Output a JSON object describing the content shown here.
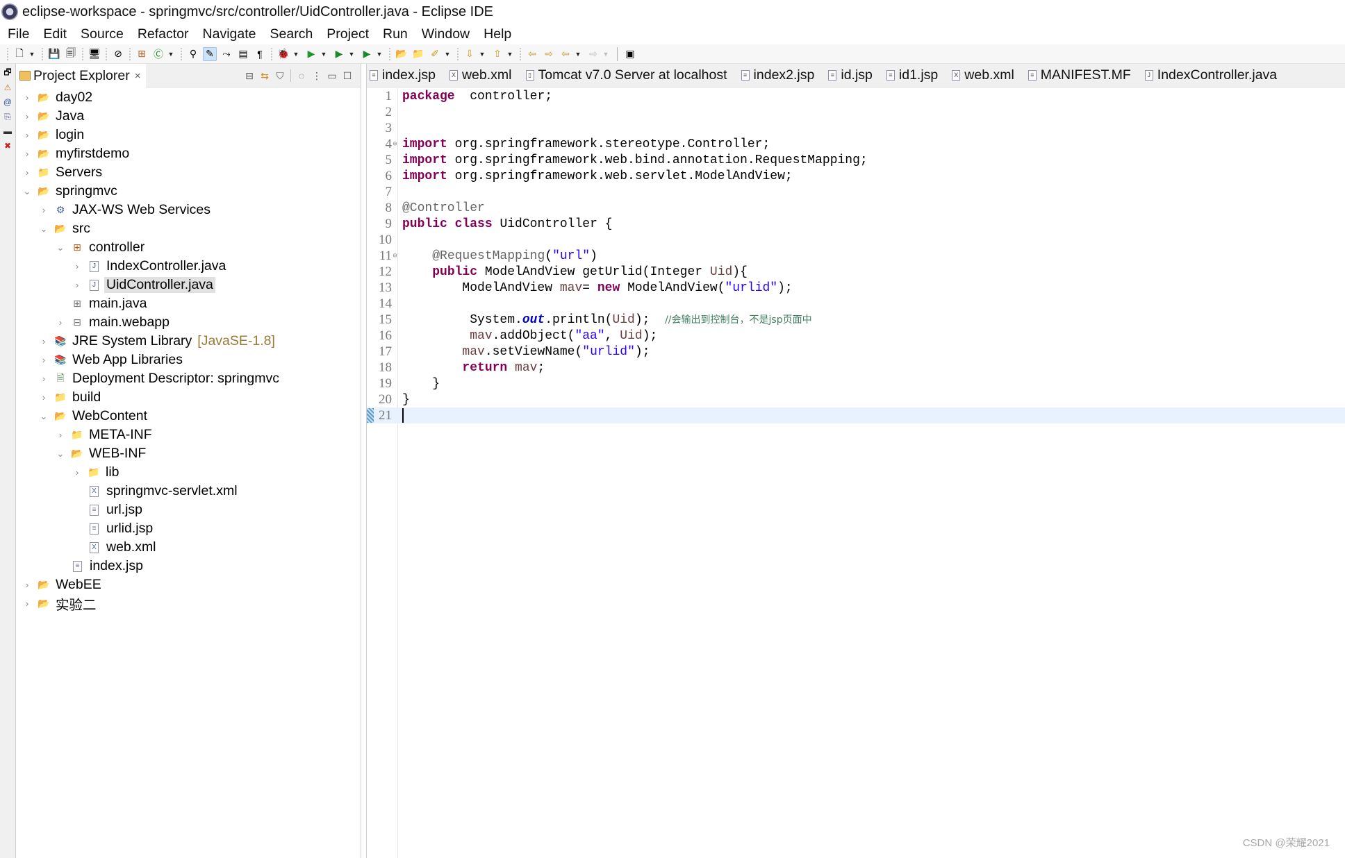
{
  "window": {
    "title": "eclipse-workspace - springmvc/src/controller/UidController.java - Eclipse IDE"
  },
  "menu": [
    "File",
    "Edit",
    "Source",
    "Refactor",
    "Navigate",
    "Search",
    "Project",
    "Run",
    "Window",
    "Help"
  ],
  "toolbar": {
    "buttons": [
      {
        "name": "new-icon",
        "glyph": "🗋"
      },
      {
        "name": "save-icon",
        "glyph": "💾"
      },
      {
        "name": "save-all-icon",
        "glyph": "🗐"
      },
      {
        "name": "console-icon",
        "glyph": "🖥"
      },
      {
        "name": "skip-breakpoints-icon",
        "glyph": "⊘"
      },
      {
        "name": "new-java-package-icon",
        "glyph": "⊞"
      },
      {
        "name": "new-java-class-icon",
        "glyph": "Ⓒ"
      },
      {
        "name": "open-type-icon",
        "glyph": "⚲"
      },
      {
        "name": "toggle-mark-occurrences-icon",
        "glyph": "✎"
      },
      {
        "name": "toggle-breadcrumb-icon",
        "glyph": "⤳"
      },
      {
        "name": "block-selection-icon",
        "glyph": "▤"
      },
      {
        "name": "show-whitespace-icon",
        "glyph": "¶"
      },
      {
        "name": "debug-icon",
        "glyph": "🐞"
      },
      {
        "name": "run-icon",
        "glyph": "▶"
      },
      {
        "name": "run-on-server-icon",
        "glyph": "▶"
      },
      {
        "name": "external-tools-icon",
        "glyph": "▶"
      },
      {
        "name": "open-project-icon",
        "glyph": "📂"
      },
      {
        "name": "open-folder-icon",
        "glyph": "📁"
      },
      {
        "name": "annotation-icon",
        "glyph": "✐"
      },
      {
        "name": "next-annotation-icon",
        "glyph": "⇩"
      },
      {
        "name": "previous-annotation-icon",
        "glyph": "⇧"
      },
      {
        "name": "last-edit-location-icon",
        "glyph": "⇦"
      },
      {
        "name": "next-edit-location-icon",
        "glyph": "⇨"
      },
      {
        "name": "back-icon",
        "glyph": "⇦"
      },
      {
        "name": "forward-icon",
        "glyph": "⇨"
      },
      {
        "name": "open-perspective-icon",
        "glyph": "▣"
      }
    ]
  },
  "trim_icons": [
    "restore-icon",
    "problems-icon",
    "javadoc-icon",
    "declaration-icon",
    "console-icon",
    "error-log-icon"
  ],
  "explorer": {
    "title": "Project Explorer",
    "close_glyph": "×",
    "actions": [
      {
        "name": "collapse-all-icon",
        "glyph": "⊟"
      },
      {
        "name": "link-with-editor-icon",
        "glyph": "⇆"
      },
      {
        "name": "filter-icon",
        "glyph": "⛉"
      },
      {
        "name": "focus-on-active-task-icon",
        "glyph": "◌"
      },
      {
        "name": "view-menu-icon",
        "glyph": "⋮"
      },
      {
        "name": "minimize-icon",
        "glyph": "▭"
      },
      {
        "name": "maximize-icon",
        "glyph": "☐"
      }
    ],
    "tree": [
      {
        "label": "day02",
        "depth": 0,
        "state": "collapsed",
        "icon": "web-project",
        "glyph": "📂"
      },
      {
        "label": "Java",
        "depth": 0,
        "state": "collapsed",
        "icon": "java-project-warning",
        "glyph": "📂"
      },
      {
        "label": "login",
        "depth": 0,
        "state": "collapsed",
        "icon": "web-project",
        "glyph": "📂"
      },
      {
        "label": "myfirstdemo",
        "depth": 0,
        "state": "collapsed",
        "icon": "web-project",
        "glyph": "📂"
      },
      {
        "label": "Servers",
        "depth": 0,
        "state": "collapsed",
        "icon": "folder",
        "glyph": "📁"
      },
      {
        "label": "springmvc",
        "depth": 0,
        "state": "expanded",
        "icon": "web-project",
        "glyph": "📂"
      },
      {
        "label": "JAX-WS Web Services",
        "depth": 1,
        "state": "collapsed",
        "icon": "web-services",
        "glyph": "⚙"
      },
      {
        "label": "src",
        "depth": 1,
        "state": "expanded",
        "icon": "source-folder",
        "glyph": "📂"
      },
      {
        "label": "controller",
        "depth": 2,
        "state": "expanded",
        "icon": "package",
        "glyph": "⊞"
      },
      {
        "label": "IndexController.java",
        "depth": 3,
        "state": "collapsed",
        "icon": "java-file",
        "glyph": "J"
      },
      {
        "label": "UidController.java",
        "depth": 3,
        "state": "collapsed",
        "icon": "java-file",
        "glyph": "J",
        "selected": true
      },
      {
        "label": "main.java",
        "depth": 2,
        "state": "leaf",
        "icon": "empty-package",
        "glyph": "⊞"
      },
      {
        "label": "main.webapp",
        "depth": 2,
        "state": "collapsed",
        "icon": "package-folder",
        "glyph": "⊟"
      },
      {
        "label": "JRE System Library",
        "depth": 1,
        "state": "collapsed",
        "icon": "library",
        "glyph": "📚",
        "decoration": "[JavaSE-1.8]"
      },
      {
        "label": "Web App Libraries",
        "depth": 1,
        "state": "collapsed",
        "icon": "library",
        "glyph": "📚"
      },
      {
        "label": "Deployment Descriptor: springmvc",
        "depth": 1,
        "state": "collapsed",
        "icon": "deployment-descriptor",
        "glyph": "🗎"
      },
      {
        "label": "build",
        "depth": 1,
        "state": "collapsed",
        "icon": "folder",
        "glyph": "📁"
      },
      {
        "label": "WebContent",
        "depth": 1,
        "state": "expanded",
        "icon": "folder",
        "glyph": "📂"
      },
      {
        "label": "META-INF",
        "depth": 2,
        "state": "collapsed",
        "icon": "folder",
        "glyph": "📁"
      },
      {
        "label": "WEB-INF",
        "depth": 2,
        "state": "expanded",
        "icon": "folder",
        "glyph": "📂"
      },
      {
        "label": "lib",
        "depth": 3,
        "state": "collapsed",
        "icon": "folder",
        "glyph": "📁"
      },
      {
        "label": "springmvc-servlet.xml",
        "depth": 3,
        "state": "leaf",
        "icon": "xml-file",
        "glyph": "X"
      },
      {
        "label": "url.jsp",
        "depth": 3,
        "state": "leaf",
        "icon": "jsp-file",
        "glyph": "≡"
      },
      {
        "label": "urlid.jsp",
        "depth": 3,
        "state": "leaf",
        "icon": "jsp-file",
        "glyph": "≡"
      },
      {
        "label": "web.xml",
        "depth": 3,
        "state": "leaf",
        "icon": "xml-file",
        "glyph": "X"
      },
      {
        "label": "index.jsp",
        "depth": 2,
        "state": "leaf",
        "icon": "jsp-file",
        "glyph": "≡"
      },
      {
        "label": "WebEE",
        "depth": 0,
        "state": "collapsed",
        "icon": "web-project",
        "glyph": "📂"
      },
      {
        "label": "实验二",
        "depth": 0,
        "state": "collapsed",
        "icon": "java-project",
        "glyph": "📂"
      }
    ]
  },
  "editor": {
    "tabs": [
      {
        "label": "index.jsp",
        "glyph": "≡"
      },
      {
        "label": "web.xml",
        "glyph": "X"
      },
      {
        "label": "Tomcat v7.0 Server at localhost",
        "glyph": "▯"
      },
      {
        "label": "index2.jsp",
        "glyph": "≡"
      },
      {
        "label": "id.jsp",
        "glyph": "≡"
      },
      {
        "label": "id1.jsp",
        "glyph": "≡"
      },
      {
        "label": "web.xml",
        "glyph": "X"
      },
      {
        "label": "MANIFEST.MF",
        "glyph": "≡"
      },
      {
        "label": "IndexController.java",
        "glyph": "J"
      }
    ],
    "lines": [
      {
        "n": "1",
        "tokens": [
          [
            "kw",
            "package"
          ],
          [
            "",
            "  controller;"
          ]
        ]
      },
      {
        "n": "2",
        "tokens": []
      },
      {
        "n": "3",
        "tokens": []
      },
      {
        "n": "4",
        "fold": "⊖",
        "tokens": [
          [
            "kw",
            "import"
          ],
          [
            "",
            " org.springframework.stereotype.Controller;"
          ]
        ]
      },
      {
        "n": "5",
        "tokens": [
          [
            "kw",
            "import"
          ],
          [
            "",
            " org.springframework.web.bind.annotation.RequestMapping;"
          ]
        ]
      },
      {
        "n": "6",
        "tokens": [
          [
            "kw",
            "import"
          ],
          [
            "",
            " org.springframework.web.servlet.ModelAndView;"
          ]
        ]
      },
      {
        "n": "7",
        "tokens": []
      },
      {
        "n": "8",
        "tokens": [
          [
            "ann",
            "@Controller"
          ]
        ]
      },
      {
        "n": "9",
        "tokens": [
          [
            "kw",
            "public"
          ],
          [
            "",
            " "
          ],
          [
            "kw",
            "class"
          ],
          [
            "",
            " UidController {"
          ]
        ]
      },
      {
        "n": "10",
        "tokens": []
      },
      {
        "n": "11",
        "fold": "⊖",
        "tokens": [
          [
            "",
            "    "
          ],
          [
            "ann",
            "@RequestMapping"
          ],
          [
            "",
            "("
          ],
          [
            "str",
            "\"url\""
          ],
          [
            "",
            ")"
          ]
        ]
      },
      {
        "n": "12",
        "tokens": [
          [
            "",
            "    "
          ],
          [
            "kw",
            "public"
          ],
          [
            "",
            " ModelAndView getUrlid(Integer "
          ],
          [
            "var",
            "Uid"
          ],
          [
            "",
            "){"
          ]
        ]
      },
      {
        "n": "13",
        "tokens": [
          [
            "",
            "        ModelAndView "
          ],
          [
            "var",
            "mav"
          ],
          [
            "",
            "= "
          ],
          [
            "kw",
            "new"
          ],
          [
            "",
            " ModelAndView("
          ],
          [
            "str",
            "\"urlid\""
          ],
          [
            "",
            ");"
          ]
        ]
      },
      {
        "n": "14",
        "tokens": []
      },
      {
        "n": "15",
        "tokens": [
          [
            "",
            "         System."
          ],
          [
            "fld",
            "out"
          ],
          [
            "",
            ".println("
          ],
          [
            "var",
            "Uid"
          ],
          [
            "",
            ");  "
          ],
          [
            "cmt",
            "//会输出到控制台，不是jsp页面中"
          ]
        ]
      },
      {
        "n": "16",
        "tokens": [
          [
            "",
            "         "
          ],
          [
            "var",
            "mav"
          ],
          [
            "",
            ".addObject("
          ],
          [
            "str",
            "\"aa\""
          ],
          [
            "",
            ", "
          ],
          [
            "var",
            "Uid"
          ],
          [
            "",
            ");"
          ]
        ]
      },
      {
        "n": "17",
        "tokens": [
          [
            "",
            "        "
          ],
          [
            "var",
            "mav"
          ],
          [
            "",
            ".setViewName("
          ],
          [
            "str",
            "\"urlid\""
          ],
          [
            "",
            ");"
          ]
        ]
      },
      {
        "n": "18",
        "tokens": [
          [
            "",
            "        "
          ],
          [
            "kw",
            "return"
          ],
          [
            "",
            " "
          ],
          [
            "var",
            "mav"
          ],
          [
            "",
            ";"
          ]
        ]
      },
      {
        "n": "19",
        "tokens": [
          [
            "",
            "    }"
          ]
        ]
      },
      {
        "n": "20",
        "tokens": [
          [
            "",
            "}"
          ]
        ]
      },
      {
        "n": "21",
        "tokens": [],
        "current": true
      }
    ]
  },
  "watermark": "CSDN @荣耀2021",
  "colors": {
    "keyword": "#7f0055",
    "string": "#2a00ff",
    "annotation": "#646464",
    "comment": "#3f7f5f",
    "static_field": "#0000c0",
    "local_var": "#6a3e3e",
    "current_line": "#e8f2fe",
    "selection": "#e1e1e1"
  }
}
